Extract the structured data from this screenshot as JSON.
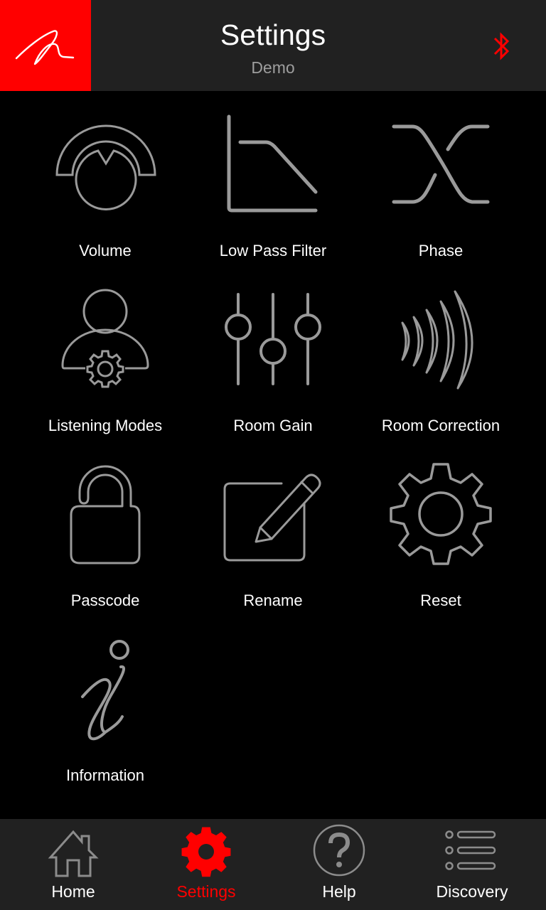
{
  "header": {
    "title": "Settings",
    "subtitle": "Demo",
    "logo_icon": "signature-logo",
    "status_icon": "bluetooth-icon"
  },
  "colors": {
    "brand": "#ff0000",
    "header_bg": "#212121",
    "icon_gray": "#9a9a9a",
    "background": "#000000"
  },
  "tiles": [
    {
      "label": "Volume",
      "icon": "volume-knob-icon"
    },
    {
      "label": "Low Pass Filter",
      "icon": "low-pass-filter-icon"
    },
    {
      "label": "Phase",
      "icon": "phase-icon"
    },
    {
      "label": "Listening Modes",
      "icon": "user-gear-icon"
    },
    {
      "label": "Room Gain",
      "icon": "sliders-icon"
    },
    {
      "label": "Room Correction",
      "icon": "sound-waves-icon"
    },
    {
      "label": "Passcode",
      "icon": "unlocked-padlock-icon"
    },
    {
      "label": "Rename",
      "icon": "edit-pencil-icon"
    },
    {
      "label": "Reset",
      "icon": "gear-icon"
    },
    {
      "label": "Information",
      "icon": "info-icon"
    }
  ],
  "tabs": [
    {
      "label": "Home",
      "icon": "home-icon",
      "active": false
    },
    {
      "label": "Settings",
      "icon": "gear-icon",
      "active": true
    },
    {
      "label": "Help",
      "icon": "help-circle-icon",
      "active": false
    },
    {
      "label": "Discovery",
      "icon": "list-icon",
      "active": false
    }
  ]
}
